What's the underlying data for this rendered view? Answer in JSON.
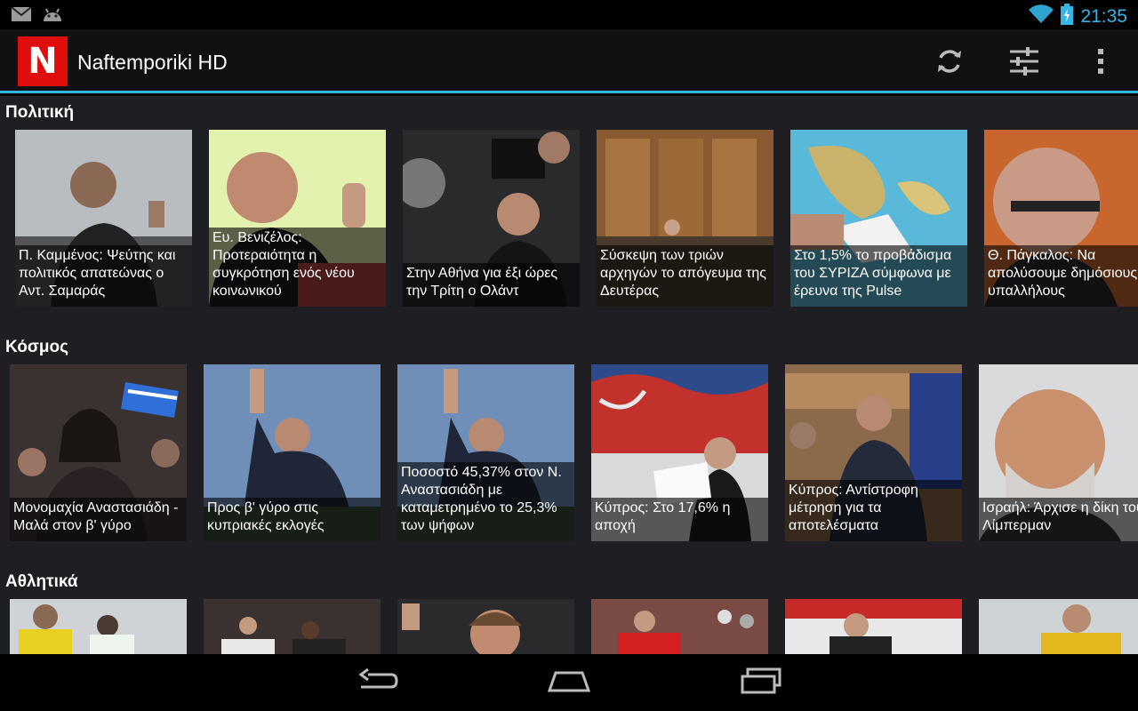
{
  "status": {
    "time": "21:35"
  },
  "app": {
    "logo_letter": "N",
    "title": "Naftemporiki HD"
  },
  "sections": [
    {
      "title": "Πολιτική",
      "items": [
        {
          "caption": "Π. Καμμένος: Ψεύτης και πολιτικός απατεώνας ο Αντ. Σαμαράς",
          "photo": "politician-at-podium"
        },
        {
          "caption": "Ευ. Βενιζέλος: Προτεραιότητα η συγκρότηση ενός νέου κοινωνικού",
          "photo": "politician-gesturing"
        },
        {
          "caption": "Στην Αθήνα για έξι ώρες την Τρίτη ο Ολάντ",
          "photo": "press-cameras"
        },
        {
          "caption": "Σύσκεψη των τριών αρχηγών το απόγευμα της Δευτέρας",
          "photo": "meeting-room"
        },
        {
          "caption": "Στο 1,5% το προβάδισμα του ΣΥΡΙΖΑ σύμφωνα με έρευνα της Pulse",
          "photo": "map-ballot"
        },
        {
          "caption": "Θ. Πάγκαλος: Να απολύσουμε δημόσιους υπαλλήλους",
          "photo": "man-glasses"
        }
      ]
    },
    {
      "title": "Κόσμος",
      "items": [
        {
          "caption": "Μονομαχία Αναστασιάδη - Μαλά στον β' γύρο",
          "photo": "crowd-flags"
        },
        {
          "caption": "Προς β' γύρο στις κυπριακές εκλογές",
          "photo": "man-waving"
        },
        {
          "caption": "Ποσοστό 45,37% στον Ν. Αναστασιάδη με καταμετρημένο το 25,3% των ψήφων",
          "photo": "man-waving"
        },
        {
          "caption": "Κύπρος: Στο 17,6% η αποχή",
          "photo": "voter-ballot"
        },
        {
          "caption": "Κύπρος: Αντίστροφη μέτρηση για τα αποτελέσματα",
          "photo": "man-voting"
        },
        {
          "caption": "Ισραήλ: Άρχισε η δίκη του Λίμπερμαν",
          "photo": "bearded-man"
        }
      ]
    },
    {
      "title": "Αθλητικά",
      "items": [
        {
          "caption": "",
          "photo": "football-players"
        },
        {
          "caption": "",
          "photo": "basketball-players"
        },
        {
          "caption": "",
          "photo": "player-celebrating"
        },
        {
          "caption": "",
          "photo": "stadium-crowd"
        },
        {
          "caption": "",
          "photo": "player-red"
        },
        {
          "caption": "",
          "photo": "player-yellow"
        }
      ]
    }
  ]
}
